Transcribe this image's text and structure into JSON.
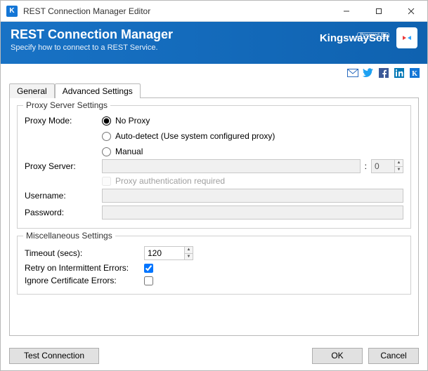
{
  "window": {
    "title": "REST Connection Manager Editor"
  },
  "header": {
    "title": "REST Connection Manager",
    "subtitle": "Specify how to connect to a REST Service.",
    "brand_powered": "Powered By",
    "brand_name": "KingswaySoft"
  },
  "tabs": {
    "general": "General",
    "advanced": "Advanced Settings"
  },
  "proxy": {
    "legend": "Proxy Server Settings",
    "mode_label": "Proxy Mode:",
    "opt_no_proxy": "No Proxy",
    "opt_auto": "Auto-detect (Use system configured proxy)",
    "opt_manual": "Manual",
    "server_label": "Proxy Server:",
    "port_value": "0",
    "auth_required": "Proxy authentication required",
    "username_label": "Username:",
    "password_label": "Password:"
  },
  "misc": {
    "legend": "Miscellaneous Settings",
    "timeout_label": "Timeout (secs):",
    "timeout_value": "120",
    "retry_label": "Retry on Intermittent Errors:",
    "ignore_cert_label": "Ignore Certificate Errors:"
  },
  "footer": {
    "test": "Test Connection",
    "ok": "OK",
    "cancel": "Cancel"
  }
}
